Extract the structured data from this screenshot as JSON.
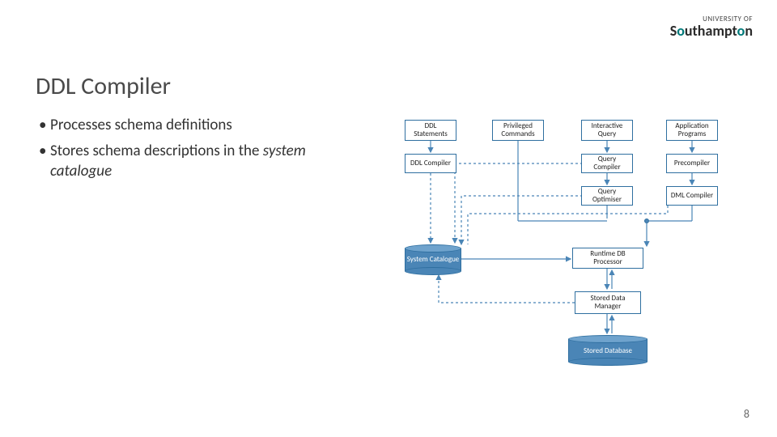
{
  "logo": {
    "top": "UNIVERSITY OF",
    "main_pre": "S",
    "main_accent": "o",
    "main_post": "uthampt",
    "main_accent2": "o",
    "main_post2": "n"
  },
  "title": "DDL Compiler",
  "bullets": [
    {
      "text": "Processes schema definitions",
      "emph": ""
    },
    {
      "text": "Stores schema descriptions in the ",
      "emph": "system catalogue"
    }
  ],
  "page_number": "8",
  "diagram": {
    "boxes": {
      "ddl_statements": "DDL Statements",
      "privileged_commands": "Privileged Commands",
      "interactive_query": "Interactive Query",
      "application_programs": "Application Programs",
      "ddl_compiler": "DDL Compiler",
      "query_compiler": "Query Compiler",
      "precompiler": "Precompiler",
      "query_optimiser": "Query Optimiser",
      "dml_compiler": "DML Compiler",
      "runtime_db_processor": "Runtime DB Processor",
      "stored_data_manager": "Stored Data Manager",
      "system_catalogue": "System Catalogue",
      "stored_database": "Stored Database"
    }
  }
}
